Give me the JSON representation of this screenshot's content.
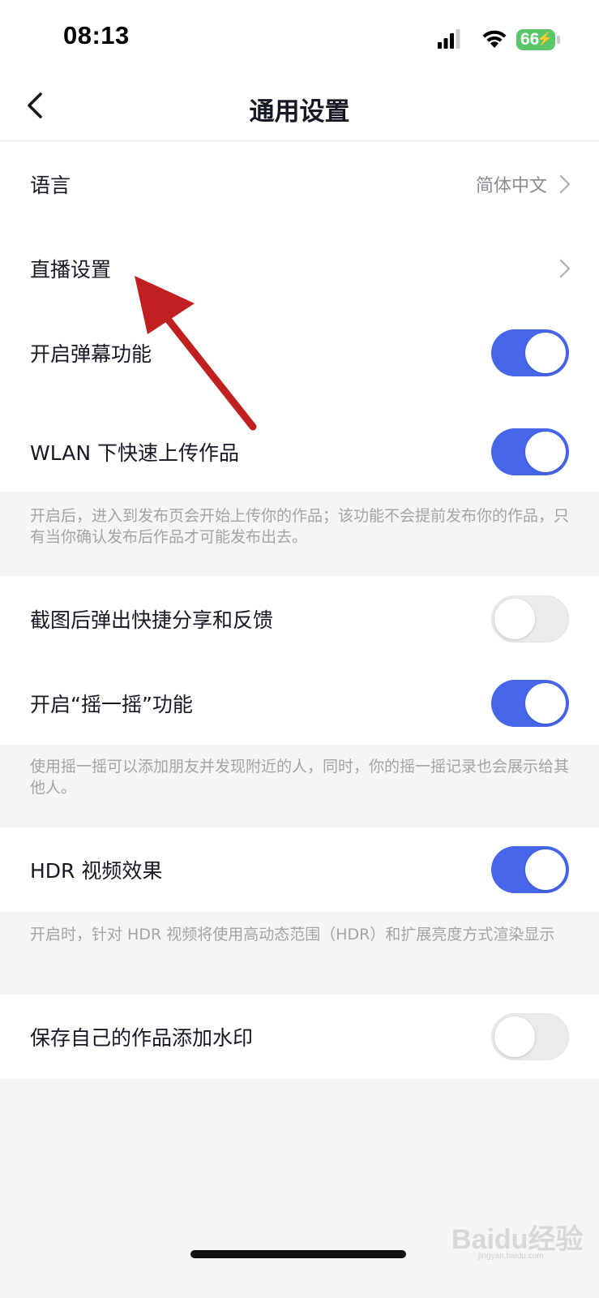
{
  "status_bar": {
    "time": "08:13",
    "battery": "66"
  },
  "header": {
    "title": "通用设置"
  },
  "settings": {
    "language": {
      "label": "语言",
      "value": "简体中文"
    },
    "live": {
      "label": "直播设置"
    },
    "danmaku": {
      "label": "开启弹幕功能",
      "enabled": true
    },
    "wlan_upload": {
      "label": "WLAN 下快速上传作品",
      "enabled": true,
      "description": "开启后，进入到发布页会开始上传你的作品；该功能不会提前发布你的作品，只有当你确认发布后作品才可能发布出去。"
    },
    "screenshot_share": {
      "label": "截图后弹出快捷分享和反馈",
      "enabled": false
    },
    "shake": {
      "label": "开启“摇一摇”功能",
      "enabled": true,
      "description": "使用摇一摇可以添加朋友并发现附近的人，同时，你的摇一摇记录也会展示给其他人。"
    },
    "hdr": {
      "label": "HDR 视频效果",
      "enabled": true,
      "description": "开启时，针对 HDR 视频将使用高动态范围（HDR）和扩展亮度方式渲染显示"
    },
    "watermark": {
      "label": "保存自己的作品添加水印",
      "enabled": false
    }
  },
  "watermark_logo": {
    "text": "Baidu经验",
    "sub": "jingyan.baidu.com"
  },
  "colors": {
    "toggle_on": "#4766ea",
    "toggle_off": "#ebebeb",
    "arrow": "#c0201f"
  }
}
